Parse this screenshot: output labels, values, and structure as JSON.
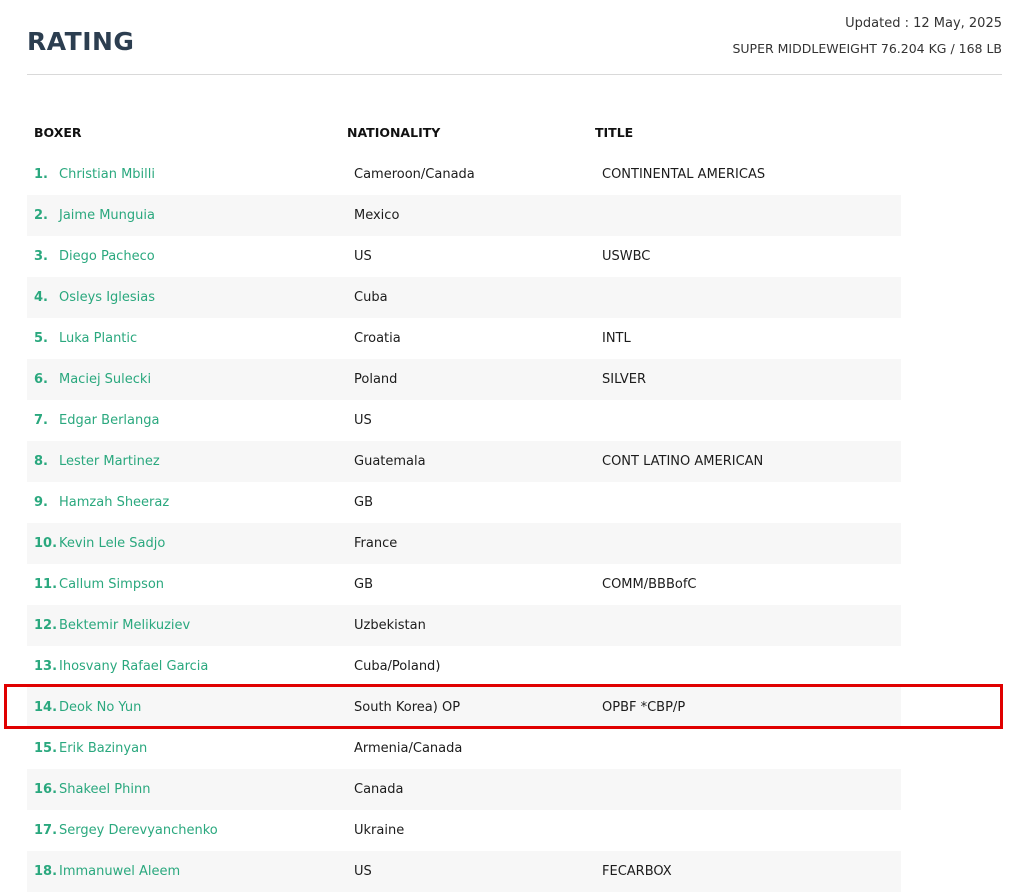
{
  "header": {
    "title": "RATING",
    "updated": "Updated : 12 May, 2025",
    "division": "SUPER MIDDLEWEIGHT 76.204 KG / 168 LB"
  },
  "columns": {
    "boxer": "BOXER",
    "nationality": "NATIONALITY",
    "title": "TITLE"
  },
  "rows": [
    {
      "rank": "1.",
      "name": "Christian Mbilli",
      "nationality": "Cameroon/Canada",
      "title": "CONTINENTAL AMERICAS"
    },
    {
      "rank": "2.",
      "name": "Jaime Munguia",
      "nationality": "Mexico",
      "title": ""
    },
    {
      "rank": "3.",
      "name": "Diego Pacheco",
      "nationality": "US",
      "title": "USWBC"
    },
    {
      "rank": "4.",
      "name": "Osleys Iglesias",
      "nationality": "Cuba",
      "title": ""
    },
    {
      "rank": "5.",
      "name": "Luka Plantic",
      "nationality": "Croatia",
      "title": "INTL"
    },
    {
      "rank": "6.",
      "name": "Maciej Sulecki",
      "nationality": "Poland",
      "title": "SILVER"
    },
    {
      "rank": "7.",
      "name": "Edgar Berlanga",
      "nationality": "US",
      "title": ""
    },
    {
      "rank": "8.",
      "name": "Lester Martinez",
      "nationality": "Guatemala",
      "title": "CONT LATINO AMERICAN"
    },
    {
      "rank": "9.",
      "name": "Hamzah Sheeraz",
      "nationality": "GB",
      "title": ""
    },
    {
      "rank": "10.",
      "name": "Kevin Lele Sadjo",
      "nationality": "France",
      "title": ""
    },
    {
      "rank": "11.",
      "name": "Callum Simpson",
      "nationality": "GB",
      "title": "COMM/BBBofC"
    },
    {
      "rank": "12.",
      "name": "Bektemir Melikuziev",
      "nationality": "Uzbekistan",
      "title": ""
    },
    {
      "rank": "13.",
      "name": "Ihosvany Rafael Garcia",
      "nationality": "Cuba/Poland)",
      "title": ""
    },
    {
      "rank": "14.",
      "name": "Deok No Yun",
      "nationality": "South Korea) OP",
      "title": "OPBF *CBP/P"
    },
    {
      "rank": "15.",
      "name": "Erik Bazinyan",
      "nationality": "Armenia/Canada",
      "title": ""
    },
    {
      "rank": "16.",
      "name": "Shakeel Phinn",
      "nationality": "Canada",
      "title": ""
    },
    {
      "rank": "17.",
      "name": "Sergey Derevyanchenko",
      "nationality": "Ukraine",
      "title": ""
    },
    {
      "rank": "18.",
      "name": "Immanuwel Aleem",
      "nationality": "US",
      "title": "FECARBOX"
    }
  ],
  "colors": {
    "accent": "#2aa87e",
    "highlight": "#e00000",
    "title": "#2c3e50"
  }
}
